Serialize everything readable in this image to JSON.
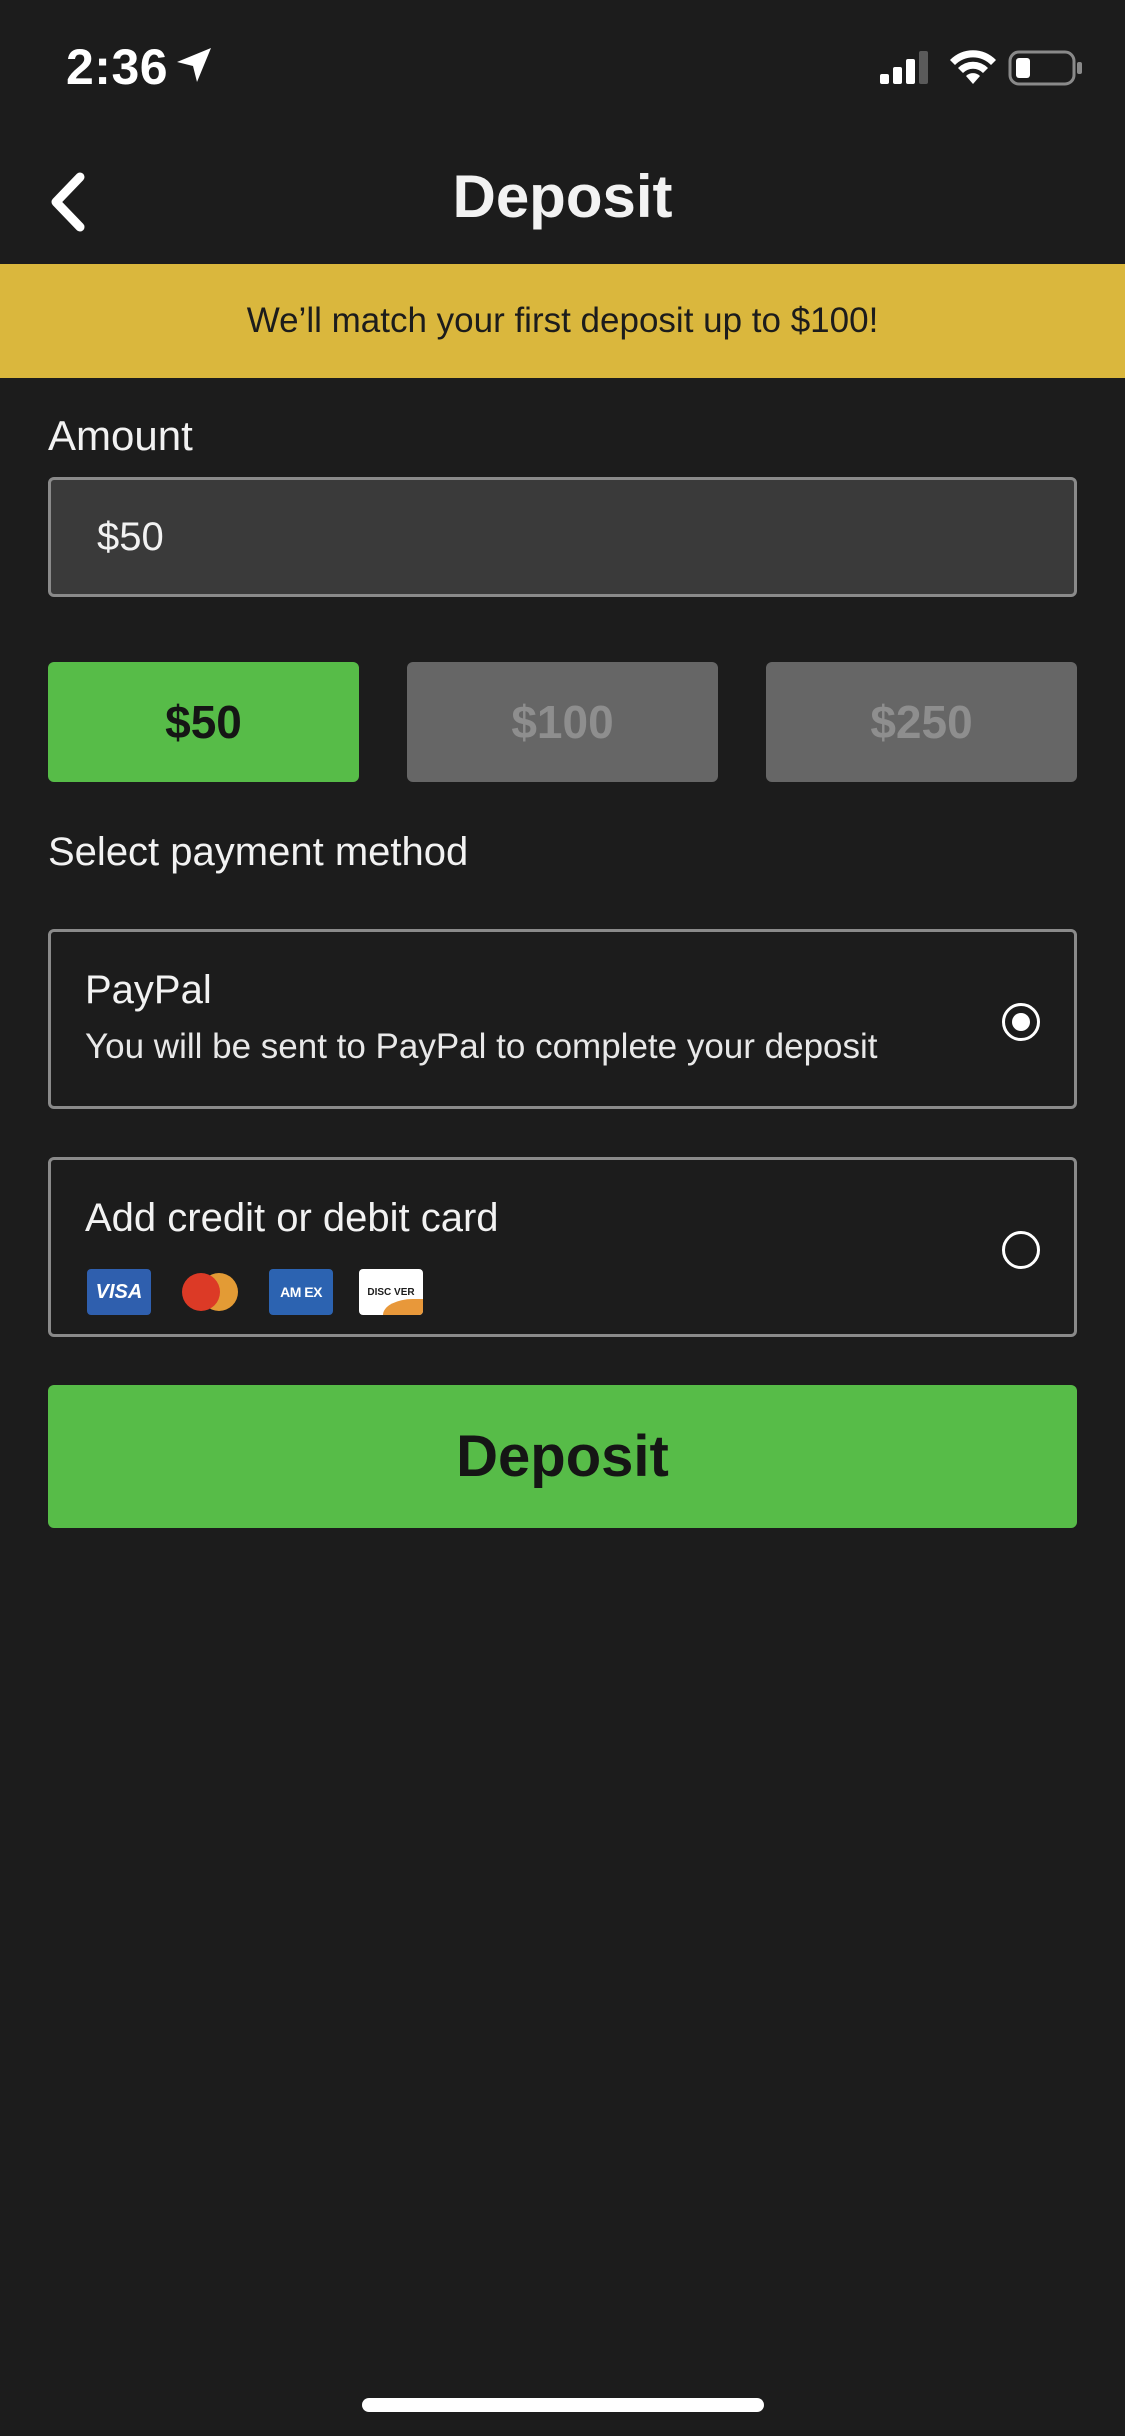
{
  "status_bar": {
    "time": "2:36"
  },
  "header": {
    "title": "Deposit"
  },
  "promo": {
    "text": "We’ll match your first deposit up to $100!"
  },
  "amount": {
    "label": "Amount",
    "value": "$50"
  },
  "quick_amounts": [
    {
      "label": "$50",
      "selected": true
    },
    {
      "label": "$100",
      "selected": false
    },
    {
      "label": "$250",
      "selected": false
    }
  ],
  "payment": {
    "heading": "Select payment method",
    "options": [
      {
        "title": "PayPal",
        "description": "You will be sent to PayPal to complete your deposit",
        "selected": true
      },
      {
        "title": "Add credit or debit card",
        "selected": false,
        "card_logos": [
          "visa-icon",
          "mastercard-icon",
          "amex-icon",
          "discover-icon"
        ]
      }
    ],
    "card_logo_text": {
      "visa": "VISA",
      "amex": "AM EX",
      "discover": "DISC VER"
    }
  },
  "deposit_button": {
    "label": "Deposit"
  },
  "colors": {
    "background": "#1c1c1c",
    "accent_green": "#57bc48",
    "promo_yellow": "#dab73d",
    "input_bg": "#3a3a3a",
    "chip_unselected": "#666666"
  }
}
